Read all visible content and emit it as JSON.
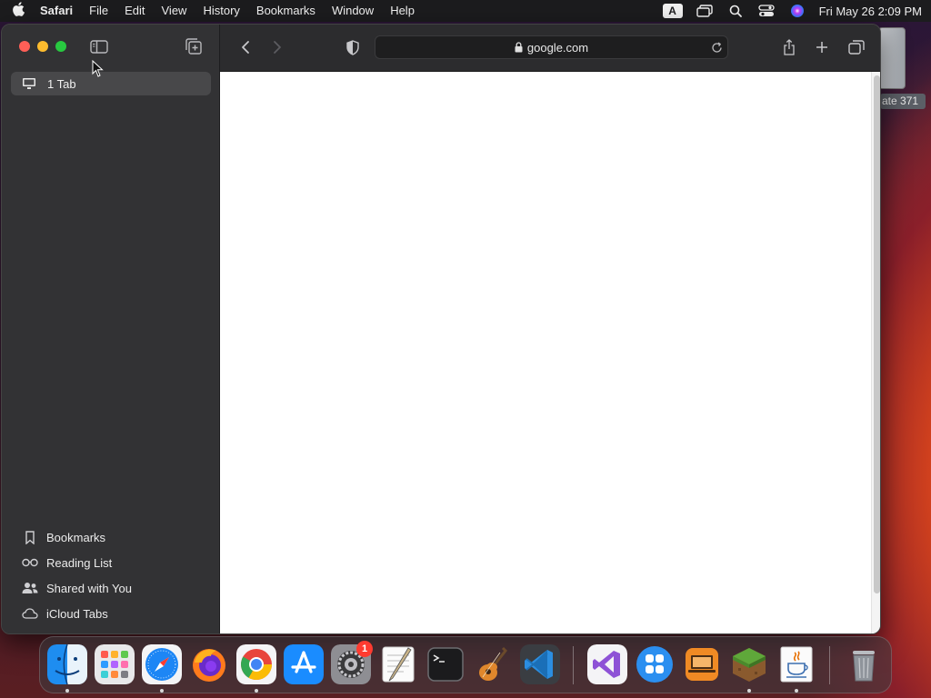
{
  "menubar": {
    "app_name": "Safari",
    "items": [
      "File",
      "Edit",
      "View",
      "History",
      "Bookmarks",
      "Window",
      "Help"
    ],
    "input_source": "A",
    "clock": "Fri May 26  2:09 PM"
  },
  "desktop": {
    "drive_label": "ate 371"
  },
  "sidebar": {
    "tab_group_label": "1 Tab",
    "links": [
      {
        "label": "Bookmarks",
        "icon": "bookmark-icon"
      },
      {
        "label": "Reading List",
        "icon": "glasses-icon"
      },
      {
        "label": "Shared with You",
        "icon": "people-icon"
      },
      {
        "label": "iCloud Tabs",
        "icon": "cloud-icon"
      }
    ]
  },
  "toolbar": {
    "url": "google.com"
  },
  "dock": {
    "apps": [
      "Finder",
      "Launchpad",
      "Safari",
      "Firefox",
      "Google Chrome",
      "App Store",
      "System Preferences",
      "TextEdit",
      "Terminal",
      "GarageBand",
      "Visual Studio Code",
      "Visual Studio",
      "Microsoft Remote Desktop",
      "Remote Desktop",
      "Minecraft",
      "Java",
      "Trash"
    ],
    "system_prefs_badge": "1"
  },
  "colors": {
    "close": "#ff5f57",
    "minimize": "#febc2e",
    "maximize": "#28c840",
    "sidebar_bg": "#323234",
    "toolbar_bg": "#2c2c2e"
  }
}
